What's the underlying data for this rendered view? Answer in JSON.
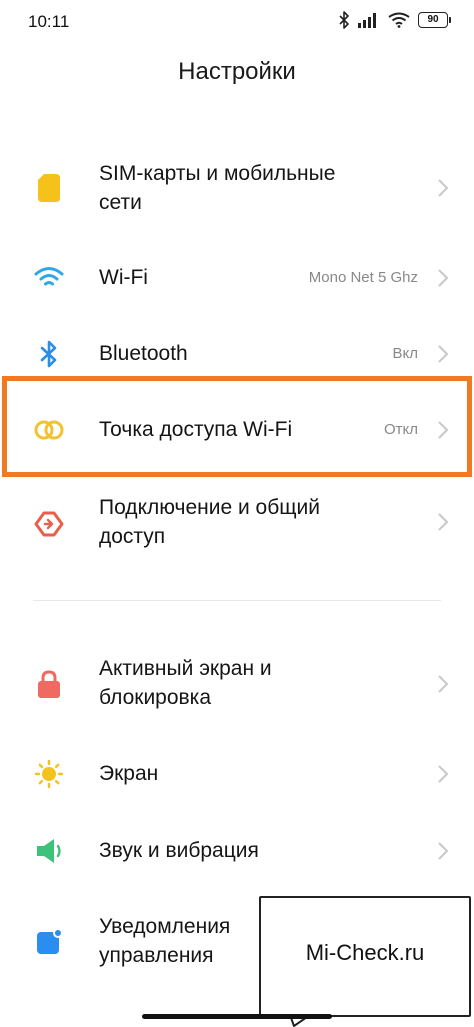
{
  "status": {
    "time": "10:11",
    "battery": "90"
  },
  "header": {
    "title": "Настройки"
  },
  "items": [
    {
      "label_line1": "SIM-карты и мобильные",
      "label_line2": "сети",
      "value": ""
    },
    {
      "label_line1": "Wi-Fi",
      "value": "Mono Net 5 Ghz"
    },
    {
      "label_line1": "Bluetooth",
      "value": "Вкл"
    },
    {
      "label_line1": "Точка доступа Wi-Fi",
      "value": "Откл"
    },
    {
      "label_line1": "Подключение и общий",
      "label_line2": "доступ",
      "value": ""
    },
    {
      "label_line1": "Активный экран и",
      "label_line2": "блокировка",
      "value": ""
    },
    {
      "label_line1": "Экран",
      "value": ""
    },
    {
      "label_line1": "Звук и вибрация",
      "value": ""
    },
    {
      "label_line1": "Уведомления",
      "label_line2": "управления",
      "value": ""
    }
  ],
  "watermark": {
    "text": "Mi-Check.ru"
  },
  "icons": {
    "sim": "sim-card-icon",
    "wifi": "wifi-icon",
    "bluetooth": "bluetooth-icon",
    "hotspot": "hotspot-icon",
    "sharing": "connection-sharing-icon",
    "lock": "lock-icon",
    "display": "sun-icon",
    "sound": "speaker-icon",
    "notifications": "notification-icon"
  },
  "colors": {
    "highlight": "#f07a24",
    "sim": "#f5c21b",
    "wifi": "#2fa7e8",
    "bluetooth": "#2b8ee6",
    "hotspot": "#f2c230",
    "sharing": "#e8604c",
    "lock": "#ef6a60",
    "display": "#f5c21b",
    "sound": "#3cc27a",
    "notifications": "#2a8ef0"
  }
}
